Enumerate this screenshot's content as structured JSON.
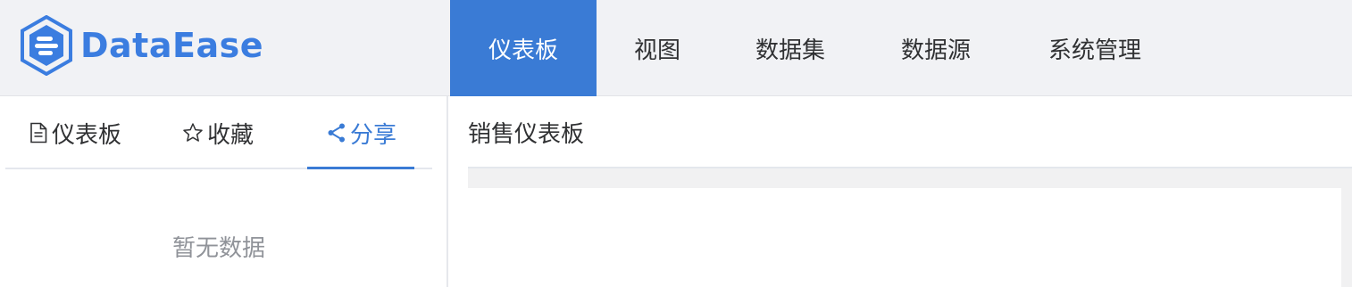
{
  "brand": {
    "name": "DataEase",
    "color": "#3b7de0"
  },
  "nav": {
    "items": [
      {
        "label": "仪表板",
        "active": true
      },
      {
        "label": "视图",
        "active": false
      },
      {
        "label": "数据集",
        "active": false
      },
      {
        "label": "数据源",
        "active": false
      },
      {
        "label": "系统管理",
        "active": false
      }
    ]
  },
  "sidebar": {
    "tabs": [
      {
        "label": "仪表板",
        "icon": "document-icon",
        "active": false
      },
      {
        "label": "收藏",
        "icon": "star-icon",
        "active": false
      },
      {
        "label": "分享",
        "icon": "share-icon",
        "active": true
      }
    ],
    "empty_text": "暂无数据"
  },
  "main": {
    "title": "销售仪表板"
  },
  "colors": {
    "accent": "#3a7bd5",
    "header_bg": "#f1f2f5",
    "muted_text": "#909399"
  }
}
